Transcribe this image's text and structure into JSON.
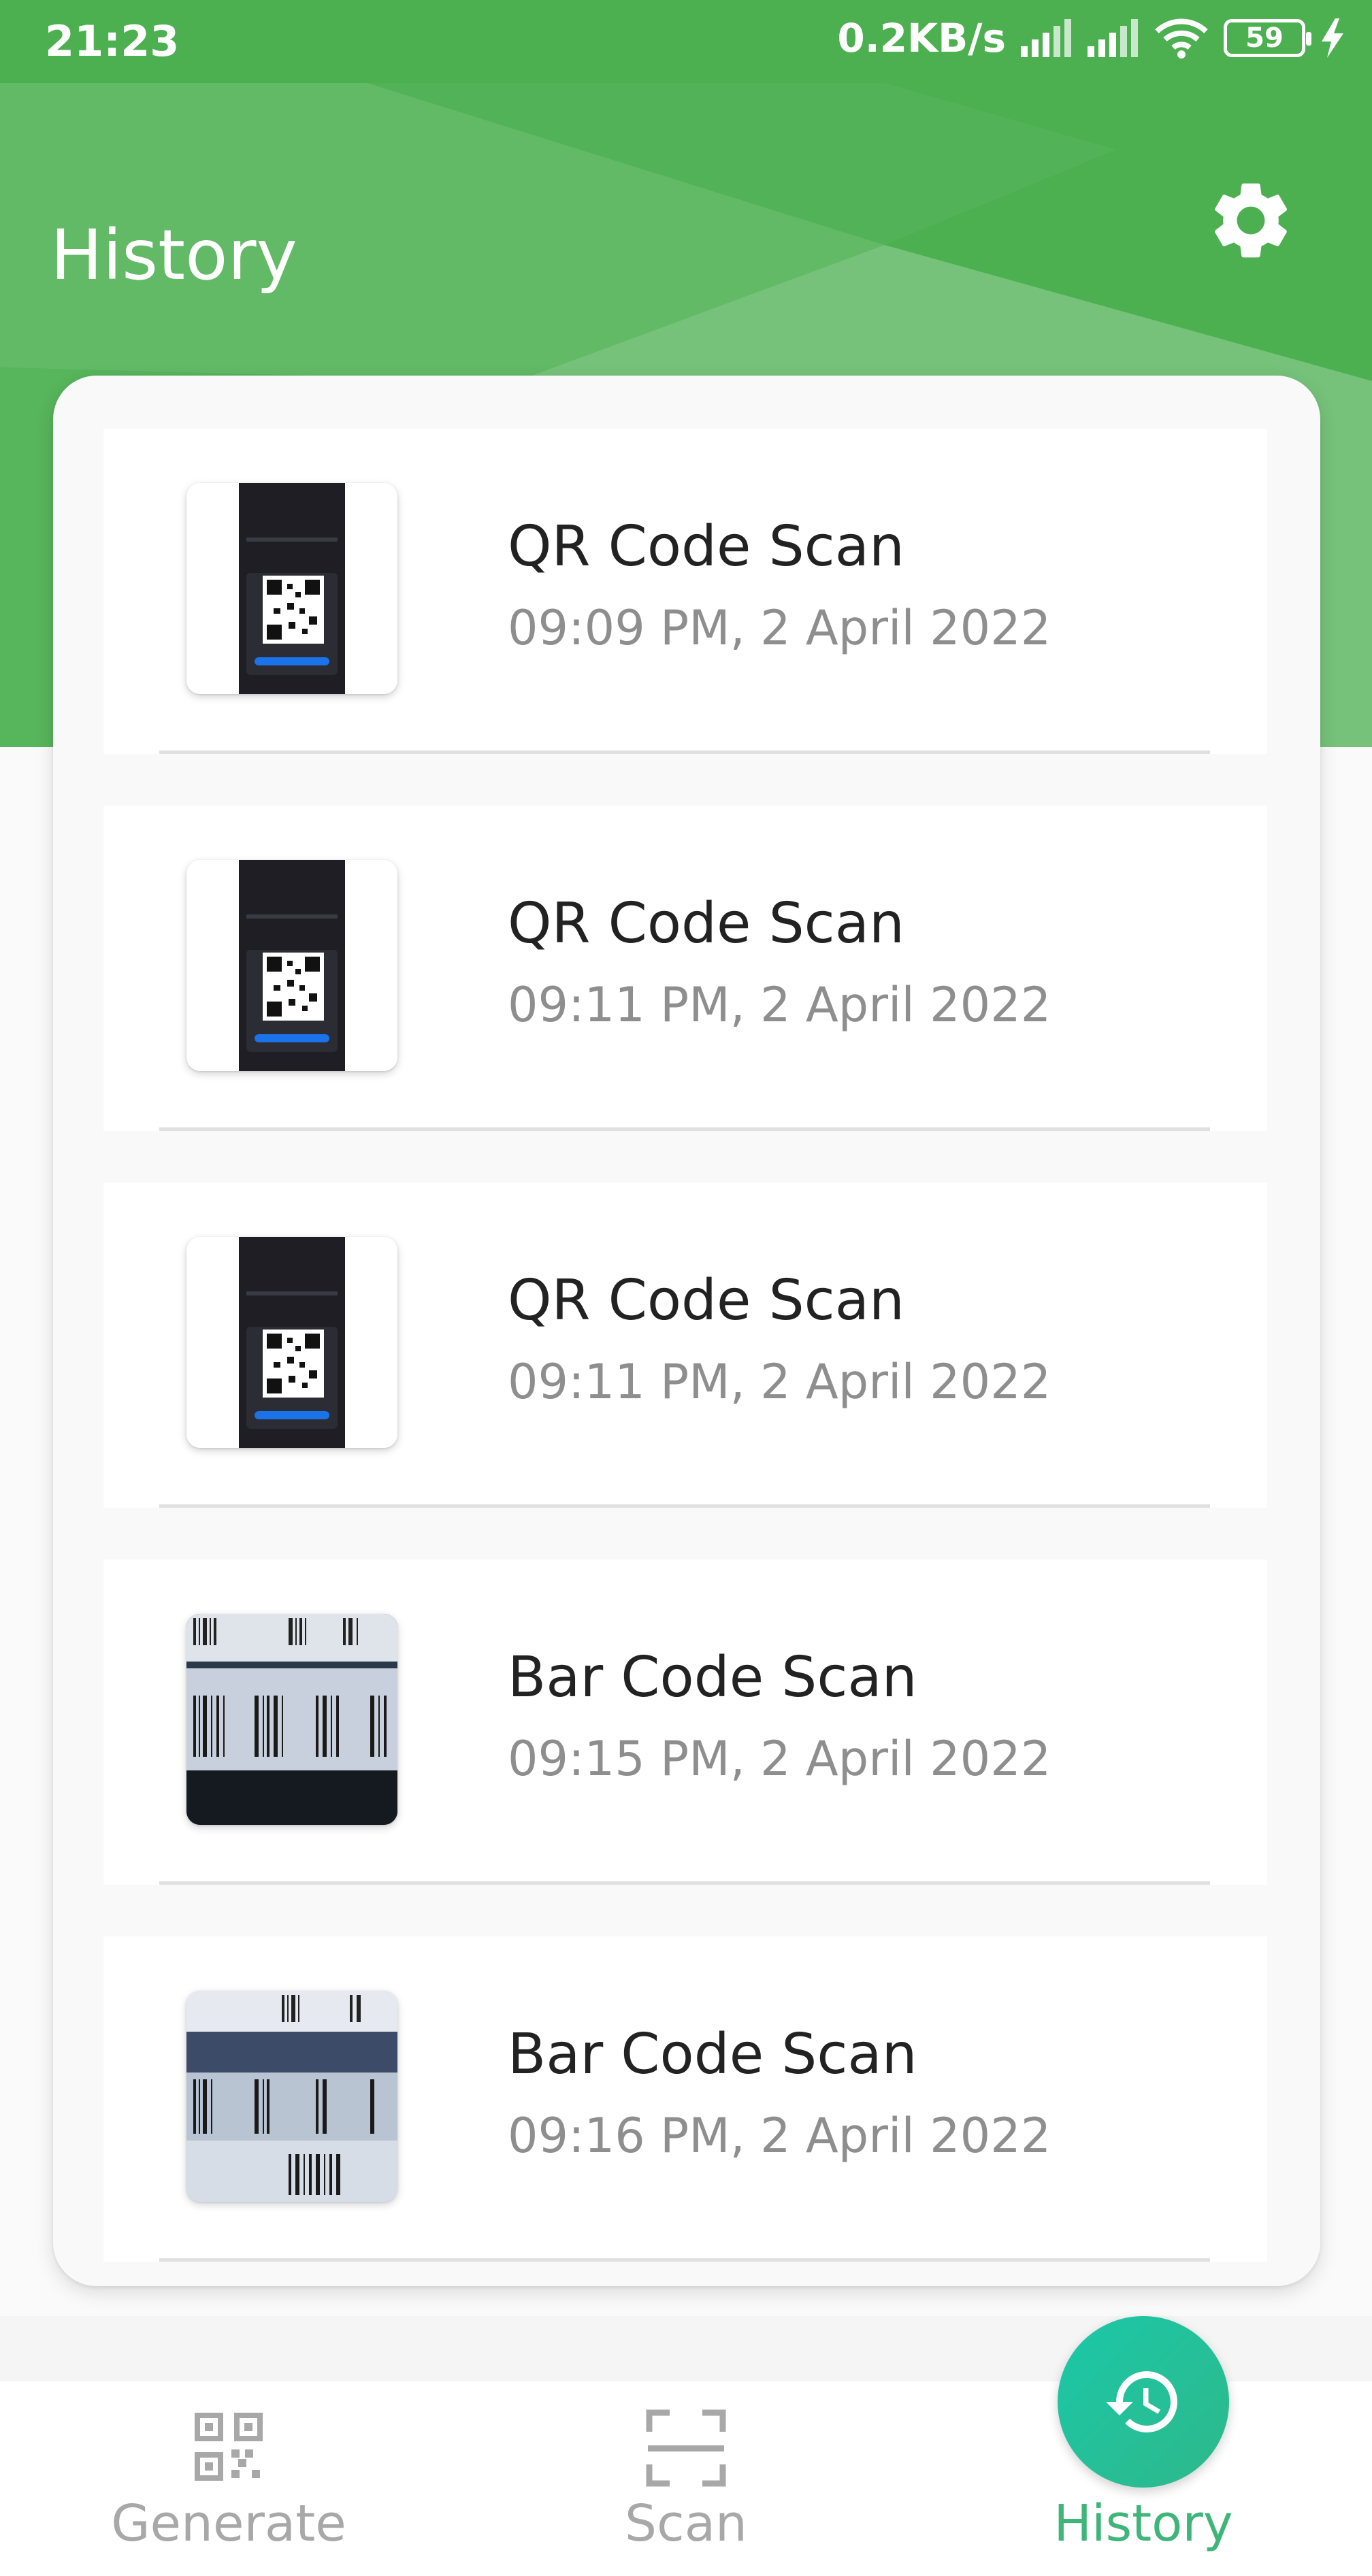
{
  "status_bar": {
    "time": "21:23",
    "network_speed": "0.2KB/s",
    "battery_level": "59"
  },
  "header": {
    "title": "History",
    "accent_color": "#4caf50"
  },
  "history": {
    "items": [
      {
        "title": "QR Code Scan",
        "timestamp": "09:09 PM, 2 April 2022",
        "thumbnail": "qr-code-screenshot"
      },
      {
        "title": "QR Code Scan",
        "timestamp": "09:11 PM, 2 April 2022",
        "thumbnail": "qr-code-screenshot"
      },
      {
        "title": "QR Code Scan",
        "timestamp": "09:11 PM, 2 April 2022",
        "thumbnail": "qr-code-screenshot"
      },
      {
        "title": "Bar Code Scan",
        "timestamp": "09:15 PM, 2 April 2022",
        "thumbnail": "barcode-photo"
      },
      {
        "title": "Bar Code Scan",
        "timestamp": "09:16 PM, 2 April 2022",
        "thumbnail": "barcode-photo"
      }
    ]
  },
  "bottom_nav": {
    "generate_label": "Generate",
    "scan_label": "Scan",
    "history_label": "History",
    "active_tab": "History",
    "active_color": "#3fb57a"
  }
}
